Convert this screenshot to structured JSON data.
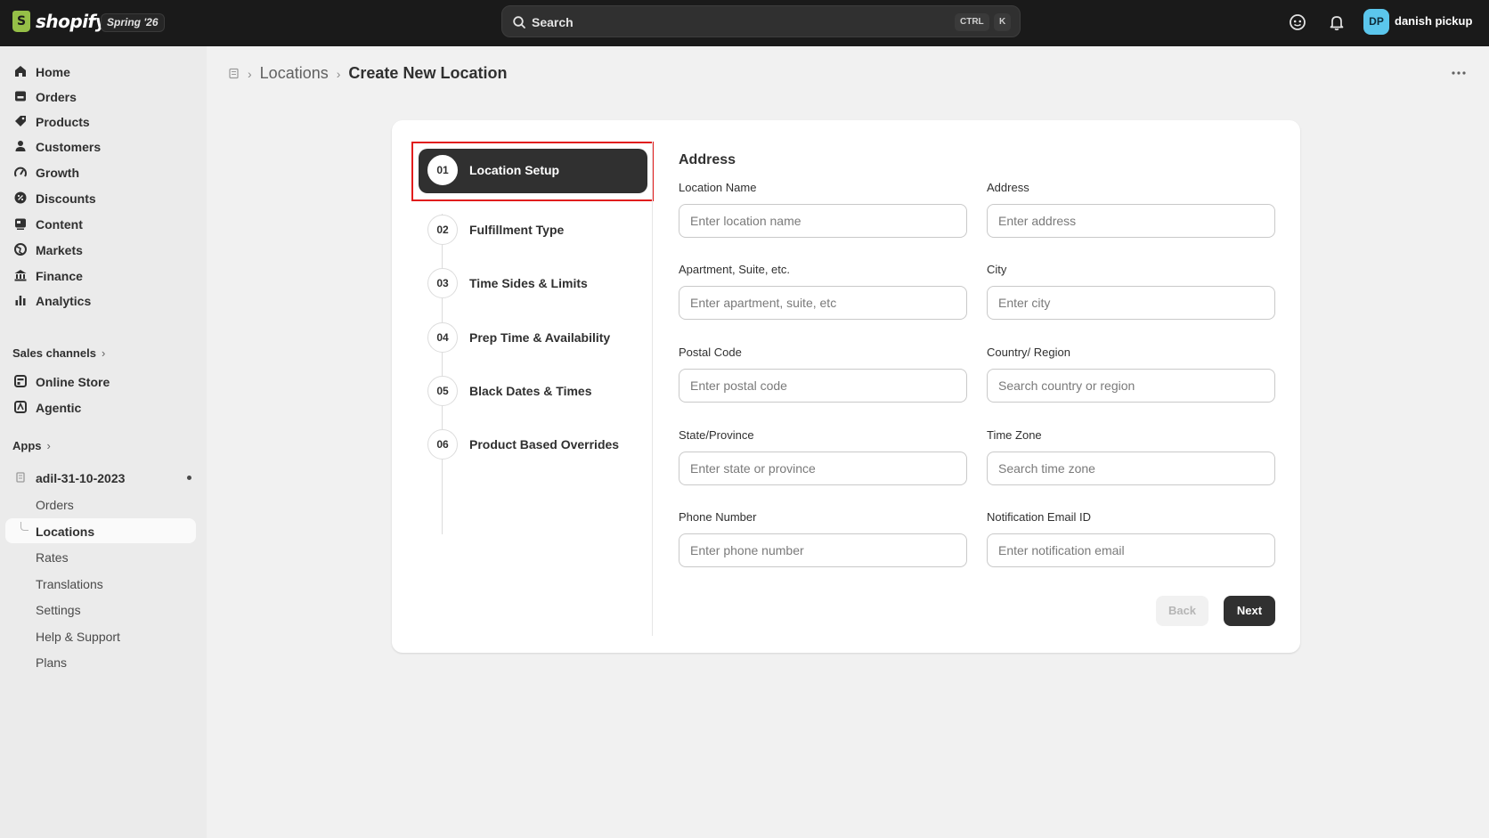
{
  "topbar": {
    "brand": "shopify",
    "season": "Spring '26",
    "search_label": "Search",
    "shortcut_ctrl": "CTRL",
    "shortcut_k": "K",
    "avatar_initials": "DP",
    "username": "danish pickup"
  },
  "sidebar": {
    "items": [
      {
        "label": "Home",
        "icon": "home-icon"
      },
      {
        "label": "Orders",
        "icon": "orders-icon"
      },
      {
        "label": "Products",
        "icon": "tag-icon"
      },
      {
        "label": "Customers",
        "icon": "person-icon"
      },
      {
        "label": "Growth",
        "icon": "growth-icon"
      },
      {
        "label": "Discounts",
        "icon": "discount-icon"
      },
      {
        "label": "Content",
        "icon": "content-icon"
      },
      {
        "label": "Markets",
        "icon": "globe-icon"
      },
      {
        "label": "Finance",
        "icon": "bank-icon"
      },
      {
        "label": "Analytics",
        "icon": "bar-chart-icon"
      }
    ],
    "sales_channels_label": "Sales channels",
    "channels": [
      {
        "label": "Online Store",
        "icon": "store-icon"
      },
      {
        "label": "Agentic",
        "icon": "agentic-icon"
      }
    ],
    "apps_label": "Apps",
    "app_name": "adil-31-10-2023",
    "app_subitems": [
      "Orders",
      "Locations",
      "Rates",
      "Translations",
      "Settings",
      "Help & Support",
      "Plans"
    ],
    "active_subitem": "Locations"
  },
  "breadcrumb": {
    "parent": "Locations",
    "current": "Create New Location"
  },
  "steps": [
    {
      "num": "01",
      "label": "Location Setup"
    },
    {
      "num": "02",
      "label": "Fulfillment Type"
    },
    {
      "num": "03",
      "label": "Time Sides & Limits"
    },
    {
      "num": "04",
      "label": "Prep Time & Availability"
    },
    {
      "num": "05",
      "label": "Black Dates & Times"
    },
    {
      "num": "06",
      "label": "Product Based Overrides"
    }
  ],
  "form": {
    "title": "Address",
    "fields": {
      "location_name": {
        "label": "Location Name",
        "placeholder": "Enter location name",
        "value": ""
      },
      "address": {
        "label": "Address",
        "placeholder": "Enter address",
        "value": ""
      },
      "apartment": {
        "label": "Apartment, Suite, etc.",
        "placeholder": "Enter apartment, suite, etc",
        "value": ""
      },
      "city": {
        "label": "City",
        "placeholder": "Enter city",
        "value": ""
      },
      "postal_code": {
        "label": "Postal Code",
        "placeholder": "Enter postal code",
        "value": ""
      },
      "country": {
        "label": "Country/ Region",
        "placeholder": "Search country or region",
        "value": ""
      },
      "state": {
        "label": "State/Province",
        "placeholder": "Enter state or province",
        "value": ""
      },
      "time_zone": {
        "label": "Time Zone",
        "placeholder": "Search time zone",
        "value": ""
      },
      "phone": {
        "label": "Phone Number",
        "placeholder": "Enter phone number",
        "value": ""
      },
      "notification_email": {
        "label": "Notification Email ID",
        "placeholder": "Enter notification email",
        "value": ""
      }
    },
    "back_label": "Back",
    "next_label": "Next"
  },
  "colors": {
    "topbar_bg": "#1a1a1a",
    "accent_dark": "#303030",
    "highlight_border": "#e11d1d",
    "avatar_bg": "#5bc6ec",
    "brand_green": "#95bf47"
  }
}
